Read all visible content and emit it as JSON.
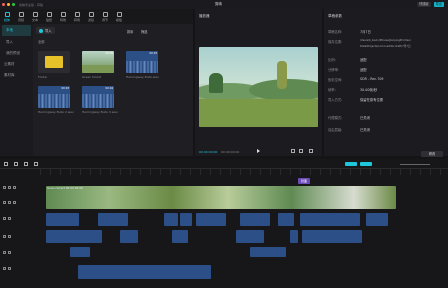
{
  "window": {
    "title": "剪映专业版 - 草稿"
  },
  "header": {
    "btn1": "快捷键",
    "btn2": "导出",
    "project_title": "剪映"
  },
  "toolbar": {
    "tools": [
      "媒体",
      "音频",
      "文本",
      "贴纸",
      "特效",
      "转场",
      "滤镜",
      "调节",
      "模板"
    ]
  },
  "leftnav": {
    "items": [
      "本地",
      "导入",
      "我的预设",
      "云素材",
      "素材库"
    ]
  },
  "media": {
    "import_label": "导入",
    "section_label": "全部",
    "sort_label": "排序",
    "filter_label": "筛选",
    "items": [
      {
        "caption": "Folder",
        "duration": ""
      },
      {
        "caption": "Green Smart",
        "duration": "00:05"
      },
      {
        "caption": "Hemingway Bulls.wav",
        "duration": "00:03"
      },
      {
        "caption": "Hemingway Bulls 2.wav",
        "duration": "00:03"
      },
      {
        "caption": "Hemingway Bulls 3.wav",
        "duration": "00:04"
      }
    ]
  },
  "player": {
    "title": "播放器",
    "current_time": "00:00:00:00",
    "total_time": "00:00:00:00"
  },
  "details": {
    "title": "草稿参数",
    "rows": [
      {
        "label": "草稿名称:",
        "value": "7月7日"
      },
      {
        "label": "保存位置:",
        "value": "/Users/b_kevin/Movies/JianyingPro/User"
      },
      {
        "label": "",
        "value": "Data/Projects/com.lveditor.draft/7月7日"
      },
      {
        "label": "比例:",
        "value": "适配"
      },
      {
        "label": "分辨率:",
        "value": "适配"
      },
      {
        "label": "色彩空间:",
        "value": "SDR - Rec.709"
      },
      {
        "label": "帧率:",
        "value": "30.00帧/秒"
      },
      {
        "label": "导入方式:",
        "value": "保留在原有位置"
      },
      {
        "label": "代理模式:",
        "value": "已关闭"
      },
      {
        "label": "自由层级:",
        "value": "已关闭"
      }
    ],
    "modify_label": "修改"
  },
  "timeline": {
    "main_clip": "Green Smart  00:00:05:00",
    "chip_label": "封面"
  },
  "colors": {
    "accent": "#1ec8dc",
    "audio": "#2b4f86",
    "video": "#1e6f78"
  }
}
